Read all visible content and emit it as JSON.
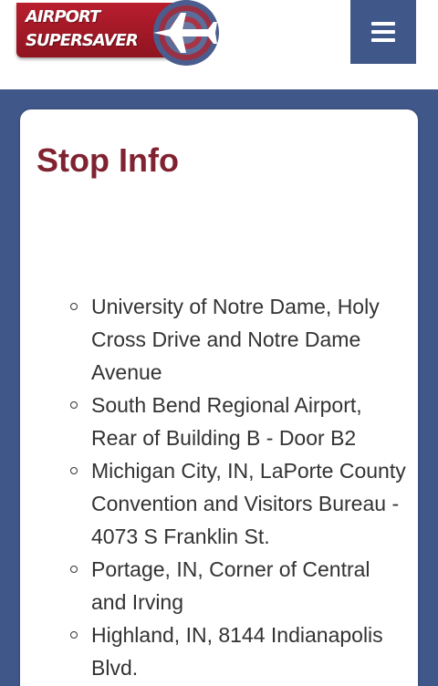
{
  "header": {
    "logo_line_1": "AIRPORT",
    "logo_line_2": "SUPERSAVER",
    "logo_icon": "airplane-target-icon",
    "menu_icon": "hamburger-menu-icon"
  },
  "colors": {
    "brand_blue": "#40578a",
    "brand_red": "#a81a28",
    "title_maroon": "#802230",
    "text": "#333333"
  },
  "main": {
    "title": "Stop Info",
    "stops": [
      {
        "label": "University of Notre Dame, Holy Cross Drive and Notre Dame Avenue"
      },
      {
        "label": "South Bend Regional Airport, Rear of Building B -  Door B2"
      },
      {
        "label": "Michigan City, IN, LaPorte County Convention and Visitors Bureau - 4073 S Franklin St."
      },
      {
        "label": "Portage, IN, Corner of Central and Irving"
      },
      {
        "label": "Highland, IN, 8144 Indianapolis Blvd."
      }
    ]
  }
}
